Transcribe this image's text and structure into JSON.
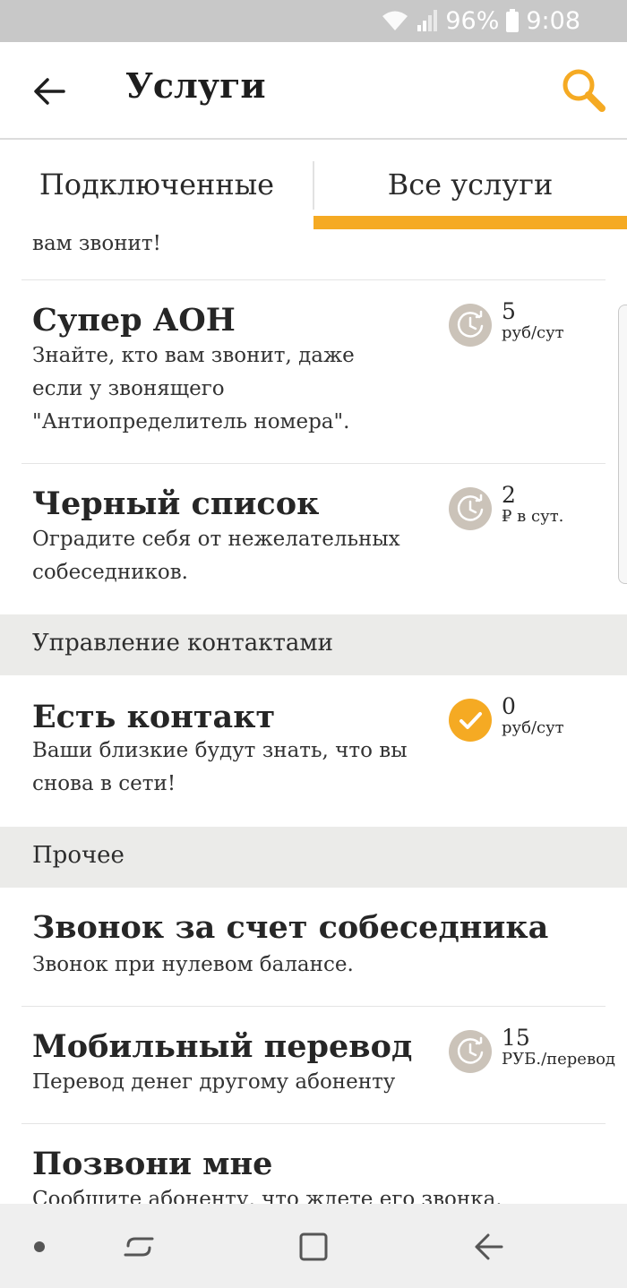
{
  "status_bar": {
    "battery": "96%",
    "time": "9:08"
  },
  "app_bar": {
    "title": "Услуги"
  },
  "tabs": [
    {
      "label": "Подключенные",
      "active": false
    },
    {
      "label": "Все услуги",
      "active": true
    }
  ],
  "truncated_top_text": "вам звонит!",
  "items": [
    {
      "title": "Супер АОН",
      "description": "Знайте, кто вам звонит, даже если у звонящего \"Антиопределитель номера\".",
      "price": "5",
      "unit": "руб/сут",
      "status": "pending"
    },
    {
      "title": "Черный список",
      "description": "Оградите себя от нежелательных собеседников.",
      "price": "2",
      "unit": "₽ в сут.",
      "status": "pending"
    }
  ],
  "sections": [
    {
      "header": "Управление контактами",
      "items": [
        {
          "title": "Есть контакт",
          "description": "Ваши близкие будут знать, что вы снова в сети!",
          "price": "0",
          "unit": "руб/сут",
          "status": "connected"
        }
      ]
    },
    {
      "header": "Прочее",
      "items": [
        {
          "title": "Звонок за счет собеседника",
          "description": "Звонок при нулевом балансе."
        },
        {
          "title": "Мобильный перевод",
          "description": "Перевод денег другому абоненту",
          "price": "15",
          "unit": "РУБ./перевод",
          "status": "pending"
        },
        {
          "title": "Позвони мне",
          "description": "Сообщите абоненту, что ждете его звонка."
        }
      ]
    }
  ],
  "colors": {
    "accent": "#f5aa23",
    "pending_icon": "#cbc3b9",
    "section_bg": "#ebebe9",
    "status_bar": "#c8c8c8"
  },
  "icons": {
    "back": "arrow-left-icon",
    "search": "search-icon",
    "pending": "clock-refresh-icon",
    "connected": "check-icon"
  }
}
